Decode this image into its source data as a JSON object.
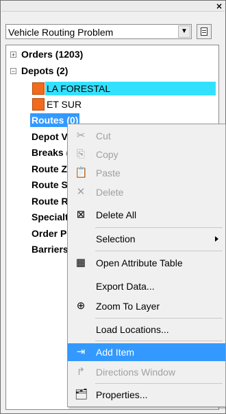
{
  "window": {
    "close_glyph": "×"
  },
  "combo": {
    "value": "Vehicle Routing Problem"
  },
  "tree": {
    "items": [
      {
        "label": "Orders (1203)",
        "expander": "+"
      },
      {
        "label": "Depots (2)",
        "expander": "−"
      },
      {
        "label": "LA FORESTAL"
      },
      {
        "label": "ET SUR"
      },
      {
        "label": "Routes (0)"
      },
      {
        "label": "Depot V"
      },
      {
        "label": "Breaks ("
      },
      {
        "label": "Route Z"
      },
      {
        "label": "Route S"
      },
      {
        "label": "Route R"
      },
      {
        "label": "Specialt"
      },
      {
        "label": "Order P"
      },
      {
        "label": "Barriers"
      }
    ],
    "swatch_color": "#f26b1d",
    "selected_color": "#33e1ff",
    "highlight_color": "#3399ff"
  },
  "context_menu": {
    "items": [
      {
        "label": "Cut",
        "icon": "scissors-icon",
        "glyph": "✂",
        "enabled": false
      },
      {
        "label": "Copy",
        "icon": "copy-icon",
        "glyph": "⎘",
        "enabled": false
      },
      {
        "label": "Paste",
        "icon": "paste-icon",
        "glyph": "📋",
        "enabled": false
      },
      {
        "label": "Delete",
        "icon": "delete-icon",
        "glyph": "✕",
        "enabled": false
      },
      {
        "label": "Delete All",
        "icon": "delete-all-icon",
        "glyph": "⊠",
        "enabled": true
      },
      {
        "label": "Selection",
        "enabled": true,
        "submenu": true
      },
      {
        "label": "Open Attribute Table",
        "icon": "table-icon",
        "glyph": "▦",
        "enabled": true
      },
      {
        "label": "Export Data...",
        "enabled": true
      },
      {
        "label": "Zoom To Layer",
        "icon": "zoom-layer-icon",
        "glyph": "⊕",
        "enabled": true
      },
      {
        "label": "Load Locations...",
        "enabled": true
      },
      {
        "label": "Add Item",
        "icon": "add-item-icon",
        "glyph": "⇥",
        "enabled": true,
        "highlighted": true
      },
      {
        "label": "Directions Window",
        "icon": "directions-icon",
        "glyph": "↱",
        "enabled": false
      },
      {
        "label": "Properties...",
        "icon": "properties-icon",
        "glyph": "🗂",
        "enabled": true
      }
    ]
  }
}
